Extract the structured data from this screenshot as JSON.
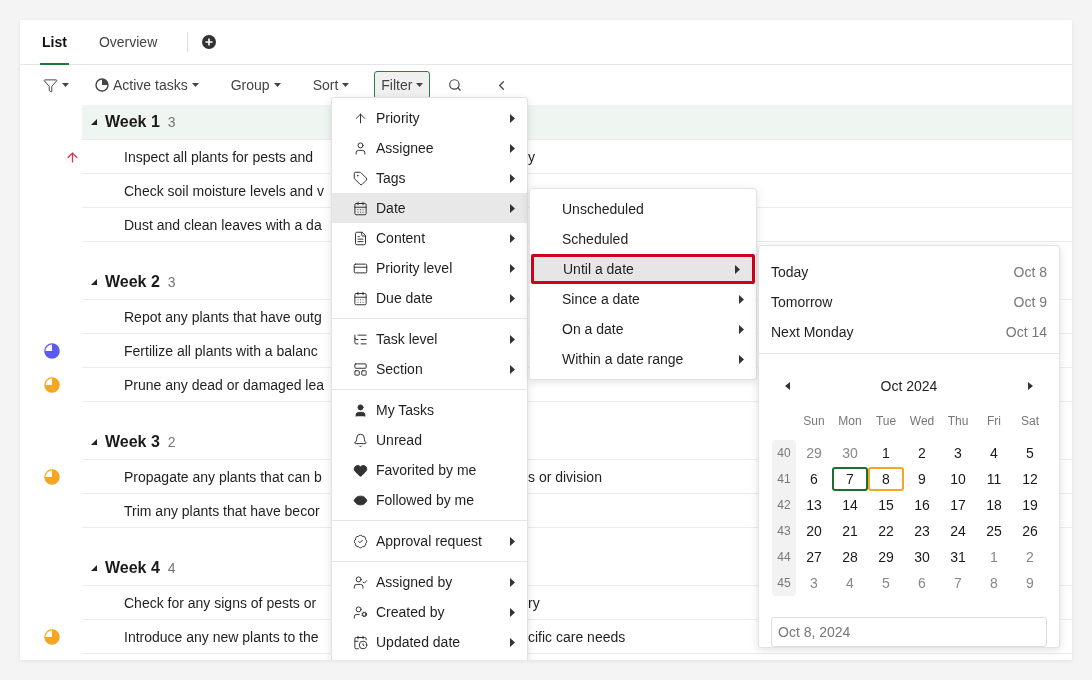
{
  "tabs": [
    {
      "label": "List",
      "selected": true
    },
    {
      "label": "Overview",
      "selected": false
    }
  ],
  "toolbar": {
    "items": [
      {
        "label": "Active tasks",
        "kind": "view",
        "active": false
      },
      {
        "label": "Group",
        "kind": "plain",
        "active": false
      },
      {
        "label": "Sort",
        "kind": "plain",
        "active": false
      },
      {
        "label": "Filter",
        "kind": "plain",
        "active": true
      }
    ]
  },
  "groups": [
    {
      "title": "Week 1",
      "count": "3",
      "highlighted": true,
      "tasks": [
        {
          "text": "Inspect all plants for pests and",
          "tail": "y",
          "kind": "priority"
        },
        {
          "text": "Check soil moisture levels and v",
          "kind": "plain"
        },
        {
          "text": "Dust and clean leaves with a da",
          "kind": "plain"
        }
      ]
    },
    {
      "title": "Week 2",
      "count": "3",
      "highlighted": false,
      "tasks": [
        {
          "text": "Repot any plants that have outg",
          "kind": "plain"
        },
        {
          "text": "Fertilize all plants with a balanc",
          "kind": "progress",
          "color": "#5b5bf0"
        },
        {
          "text": "Prune any dead or damaged lea",
          "kind": "progress",
          "color": "#f5a623"
        }
      ]
    },
    {
      "title": "Week 3",
      "count": "2",
      "highlighted": false,
      "tasks": [
        {
          "text": "Propagate any plants that can b",
          "tail": "s or division",
          "kind": "progress",
          "color": "#f5a623"
        },
        {
          "text": "Trim any plants that have becor",
          "kind": "plain"
        }
      ]
    },
    {
      "title": "Week 4",
      "count": "4",
      "highlighted": false,
      "tasks": [
        {
          "text": "Check for any signs of pests or",
          "tail": "ry",
          "kind": "plain"
        },
        {
          "text": "Introduce any new plants to the",
          "tail": "cific care needs",
          "kind": "progress",
          "color": "#f5a623"
        }
      ]
    }
  ],
  "filter_menu": {
    "sections": [
      [
        {
          "label": "Priority",
          "submenu": true,
          "selected": false
        },
        {
          "label": "Assignee",
          "submenu": true,
          "selected": false
        },
        {
          "label": "Tags",
          "submenu": true,
          "selected": false
        },
        {
          "label": "Date",
          "submenu": true,
          "selected": true
        },
        {
          "label": "Content",
          "submenu": true,
          "selected": false
        },
        {
          "label": "Priority level",
          "submenu": true,
          "selected": false
        },
        {
          "label": "Due date",
          "submenu": true,
          "selected": false
        }
      ],
      [
        {
          "label": "Task level",
          "submenu": true,
          "selected": false
        },
        {
          "label": "Section",
          "submenu": true,
          "selected": false
        }
      ],
      [
        {
          "label": "My Tasks",
          "submenu": false,
          "selected": false
        },
        {
          "label": "Unread",
          "submenu": false,
          "selected": false
        },
        {
          "label": "Favorited by me",
          "submenu": false,
          "selected": false
        },
        {
          "label": "Followed by me",
          "submenu": false,
          "selected": false
        }
      ],
      [
        {
          "label": "Approval request",
          "submenu": true,
          "selected": false
        }
      ],
      [
        {
          "label": "Assigned by",
          "submenu": true,
          "selected": false
        },
        {
          "label": "Created by",
          "submenu": true,
          "selected": false
        },
        {
          "label": "Updated date",
          "submenu": true,
          "selected": false
        }
      ]
    ]
  },
  "date_menu": {
    "items": [
      {
        "label": "Unscheduled",
        "submenu": false,
        "selected": false
      },
      {
        "label": "Scheduled",
        "submenu": false,
        "selected": false
      },
      {
        "label": "Until a date",
        "submenu": true,
        "selected": true
      },
      {
        "label": "Since a date",
        "submenu": true,
        "selected": false
      },
      {
        "label": "On a date",
        "submenu": true,
        "selected": false
      },
      {
        "label": "Within a date range",
        "submenu": true,
        "selected": false
      }
    ]
  },
  "date_panel": {
    "shortcuts": [
      {
        "label": "Today",
        "date": "Oct 8"
      },
      {
        "label": "Tomorrow",
        "date": "Oct 9"
      },
      {
        "label": "Next Monday",
        "date": "Oct 14"
      }
    ],
    "month": "Oct 2024",
    "weekdays": [
      "Sun",
      "Mon",
      "Tue",
      "Wed",
      "Thu",
      "Fri",
      "Sat"
    ],
    "weeks": [
      {
        "number": "40",
        "days": [
          {
            "d": "29",
            "muted": true,
            "selected": false,
            "today": false
          },
          {
            "d": "30",
            "muted": true,
            "selected": false,
            "today": false
          },
          {
            "d": "1",
            "muted": false,
            "selected": false,
            "today": false
          },
          {
            "d": "2",
            "muted": false,
            "selected": false,
            "today": false
          },
          {
            "d": "3",
            "muted": false,
            "selected": false,
            "today": false
          },
          {
            "d": "4",
            "muted": false,
            "selected": false,
            "today": false
          },
          {
            "d": "5",
            "muted": false,
            "selected": false,
            "today": false
          }
        ]
      },
      {
        "number": "41",
        "days": [
          {
            "d": "6",
            "muted": false,
            "selected": false,
            "today": false
          },
          {
            "d": "7",
            "muted": false,
            "selected": true,
            "today": false
          },
          {
            "d": "8",
            "muted": false,
            "selected": false,
            "today": true
          },
          {
            "d": "9",
            "muted": false,
            "selected": false,
            "today": false
          },
          {
            "d": "10",
            "muted": false,
            "selected": false,
            "today": false
          },
          {
            "d": "11",
            "muted": false,
            "selected": false,
            "today": false
          },
          {
            "d": "12",
            "muted": false,
            "selected": false,
            "today": false
          }
        ]
      },
      {
        "number": "42",
        "days": [
          {
            "d": "13",
            "muted": false,
            "selected": false,
            "today": false
          },
          {
            "d": "14",
            "muted": false,
            "selected": false,
            "today": false
          },
          {
            "d": "15",
            "muted": false,
            "selected": false,
            "today": false
          },
          {
            "d": "16",
            "muted": false,
            "selected": false,
            "today": false
          },
          {
            "d": "17",
            "muted": false,
            "selected": false,
            "today": false
          },
          {
            "d": "18",
            "muted": false,
            "selected": false,
            "today": false
          },
          {
            "d": "19",
            "muted": false,
            "selected": false,
            "today": false
          }
        ]
      },
      {
        "number": "43",
        "days": [
          {
            "d": "20",
            "muted": false,
            "selected": false,
            "today": false
          },
          {
            "d": "21",
            "muted": false,
            "selected": false,
            "today": false
          },
          {
            "d": "22",
            "muted": false,
            "selected": false,
            "today": false
          },
          {
            "d": "23",
            "muted": false,
            "selected": false,
            "today": false
          },
          {
            "d": "24",
            "muted": false,
            "selected": false,
            "today": false
          },
          {
            "d": "25",
            "muted": false,
            "selected": false,
            "today": false
          },
          {
            "d": "26",
            "muted": false,
            "selected": false,
            "today": false
          }
        ]
      },
      {
        "number": "44",
        "days": [
          {
            "d": "27",
            "muted": false,
            "selected": false,
            "today": false
          },
          {
            "d": "28",
            "muted": false,
            "selected": false,
            "today": false
          },
          {
            "d": "29",
            "muted": false,
            "selected": false,
            "today": false
          },
          {
            "d": "30",
            "muted": false,
            "selected": false,
            "today": false
          },
          {
            "d": "31",
            "muted": false,
            "selected": false,
            "today": false
          },
          {
            "d": "1",
            "muted": true,
            "selected": false,
            "today": false
          },
          {
            "d": "2",
            "muted": true,
            "selected": false,
            "today": false
          }
        ]
      },
      {
        "number": "45",
        "days": [
          {
            "d": "3",
            "muted": true,
            "selected": false,
            "today": false
          },
          {
            "d": "4",
            "muted": true,
            "selected": false,
            "today": false
          },
          {
            "d": "5",
            "muted": true,
            "selected": false,
            "today": false
          },
          {
            "d": "6",
            "muted": true,
            "selected": false,
            "today": false
          },
          {
            "d": "7",
            "muted": true,
            "selected": false,
            "today": false
          },
          {
            "d": "8",
            "muted": true,
            "selected": false,
            "today": false
          },
          {
            "d": "9",
            "muted": true,
            "selected": false,
            "today": false
          }
        ]
      }
    ],
    "input": {
      "placeholder": "Oct 8, 2024"
    }
  }
}
